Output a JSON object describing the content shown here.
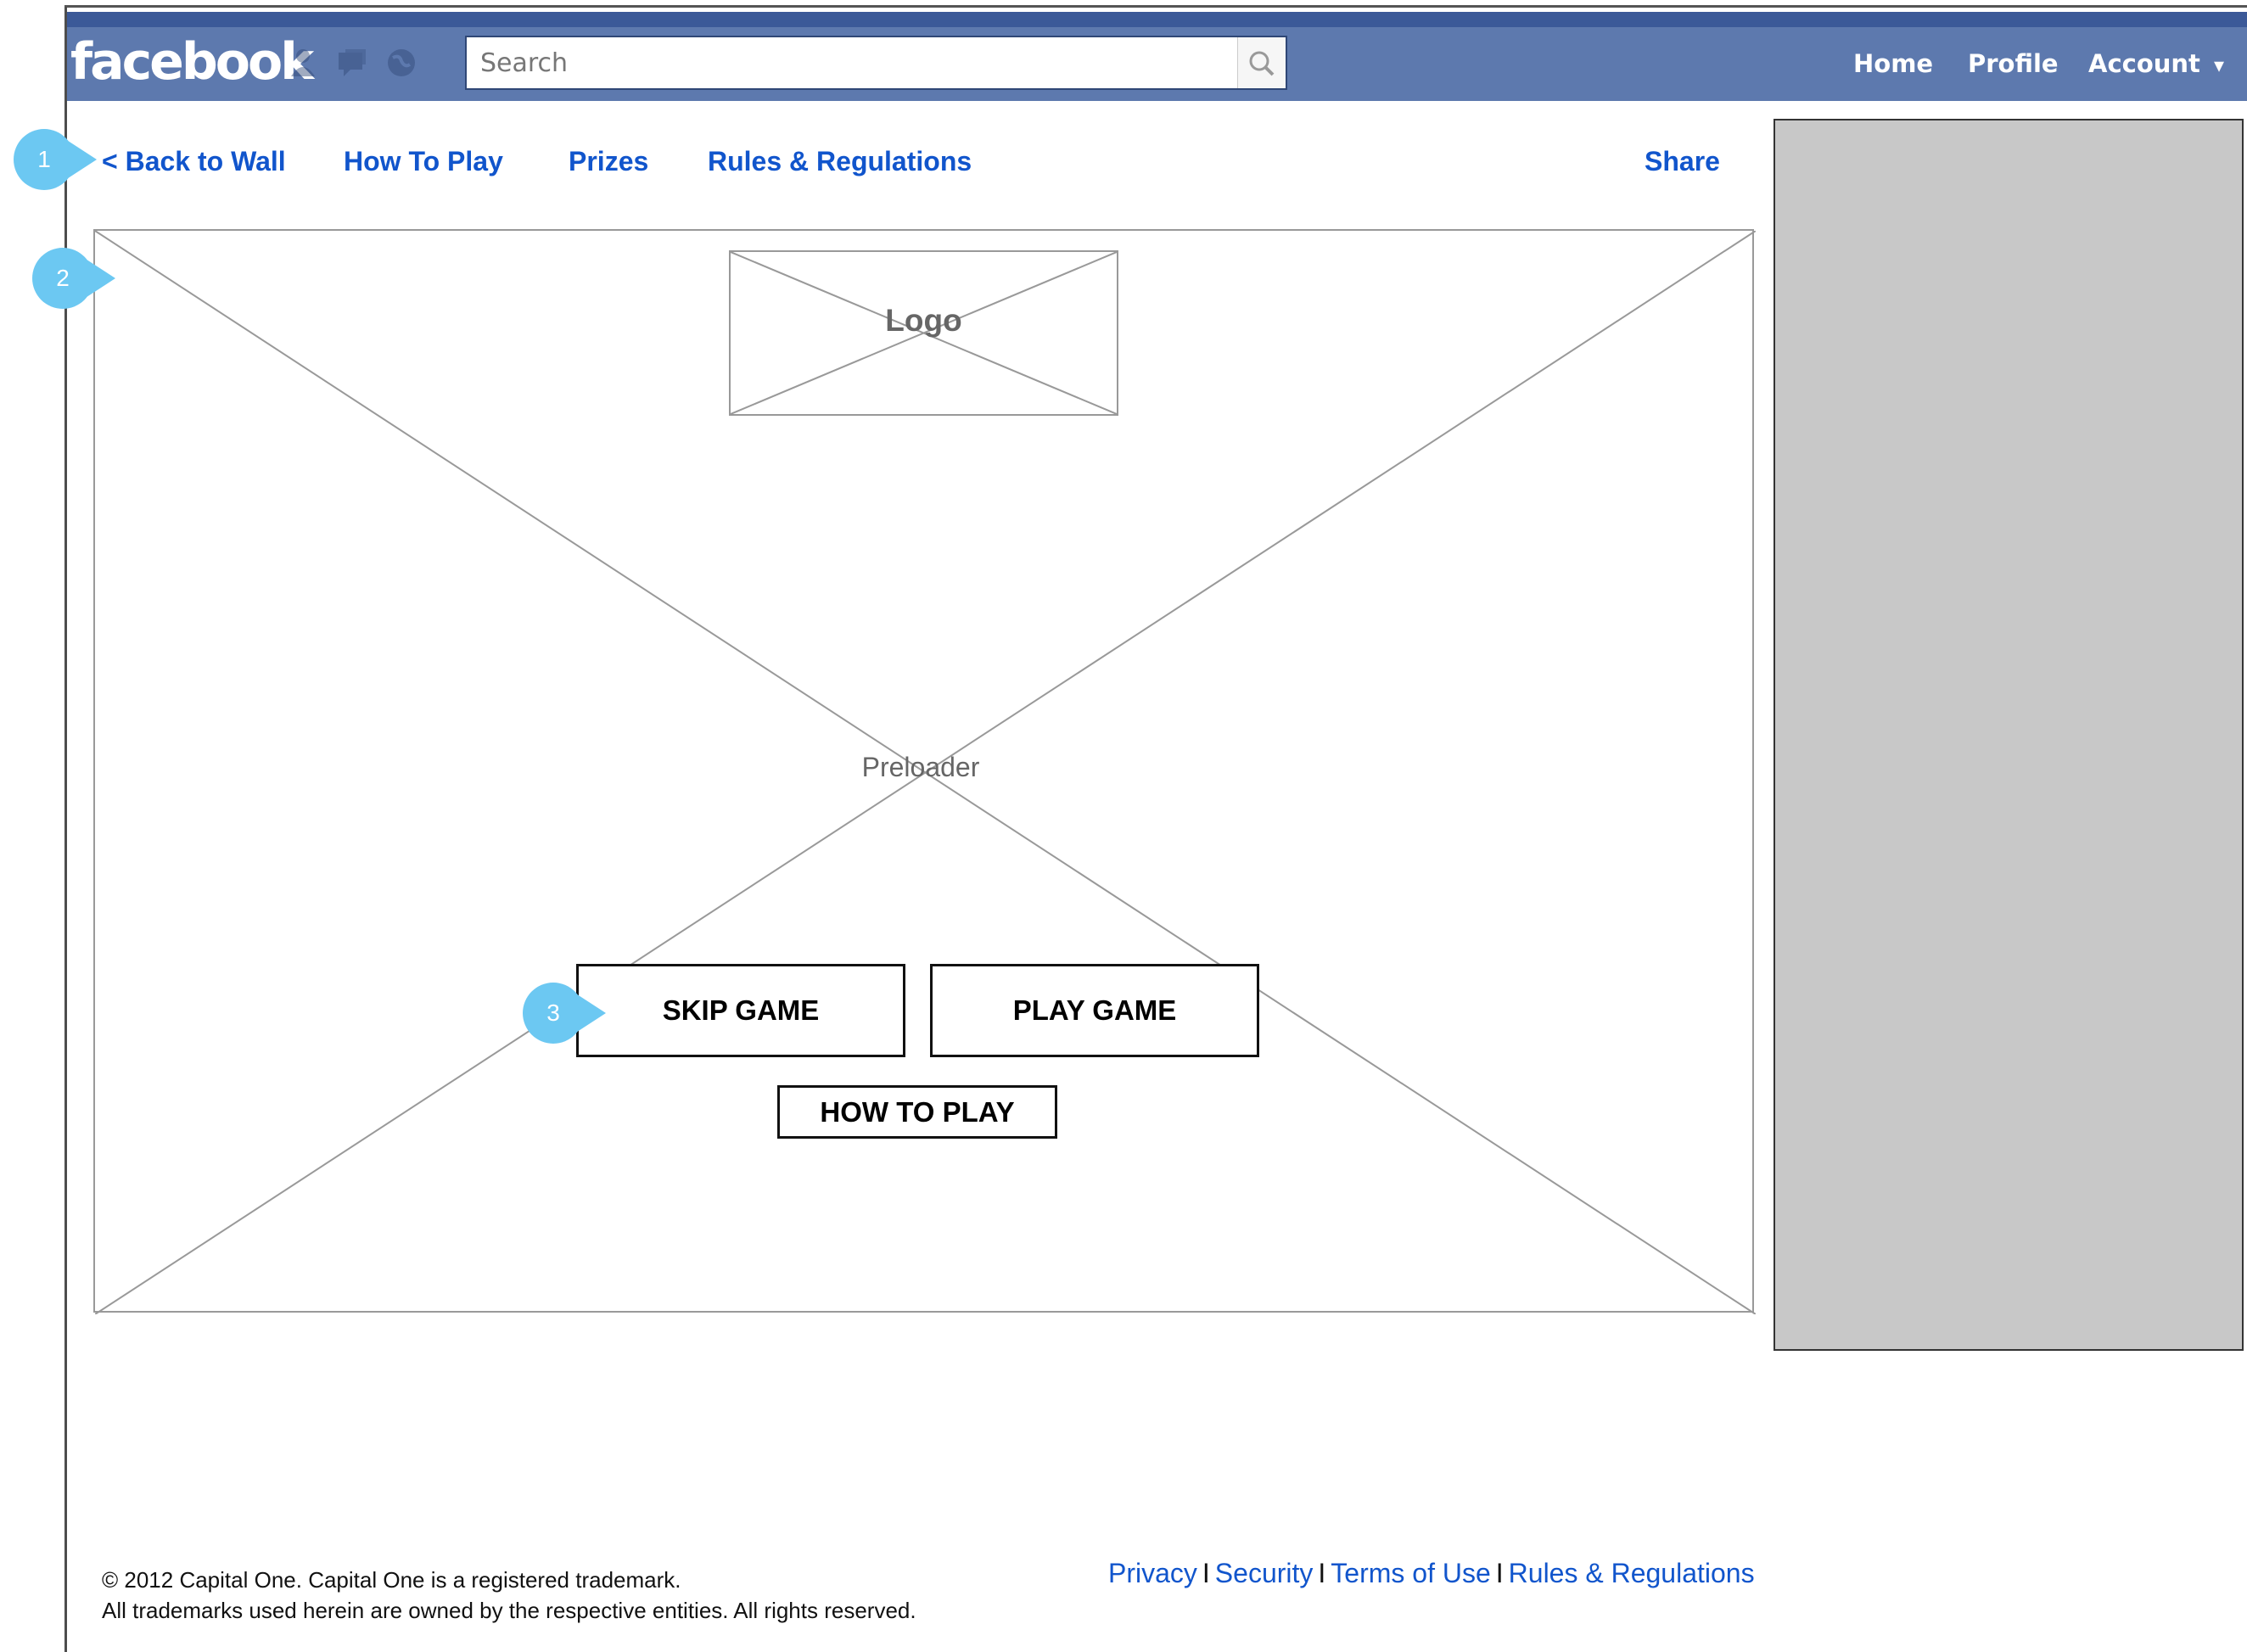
{
  "facebook_bar": {
    "logo": "facebook",
    "search": {
      "placeholder": "Search",
      "value": ""
    },
    "nav": {
      "home": "Home",
      "profile": "Profile",
      "account": "Account",
      "account_caret": "▾"
    },
    "icons": [
      "friend-requests-icon",
      "messages-icon",
      "notifications-icon",
      "search-icon"
    ]
  },
  "subnav": {
    "back": "< Back to Wall",
    "how_to_play": "How To Play",
    "prizes": "Prizes",
    "rules": "Rules & Regulations",
    "share": "Share"
  },
  "callouts": [
    "1",
    "2",
    "3"
  ],
  "game": {
    "logo_label": "Logo",
    "preloader_label": "Preloader",
    "skip": "SKIP GAME",
    "play": "PLAY GAME",
    "how_to_play": "HOW TO PLAY"
  },
  "footer": {
    "copyright_line1": "© 2012 Capital One. Capital One is a registered trademark.",
    "copyright_line2": "All trademarks used herein are owned by the respective entities. All rights reserved.",
    "links": [
      "Privacy",
      "Security",
      "Terms of Use",
      "Rules & Regulations"
    ],
    "separator": "I"
  },
  "colors": {
    "fb_bar": "#5d79ae",
    "fb_bar_top": "#3b5998",
    "link": "#1155cc",
    "callout": "#6cc8f2",
    "sidebar": "#c8c8c8"
  }
}
